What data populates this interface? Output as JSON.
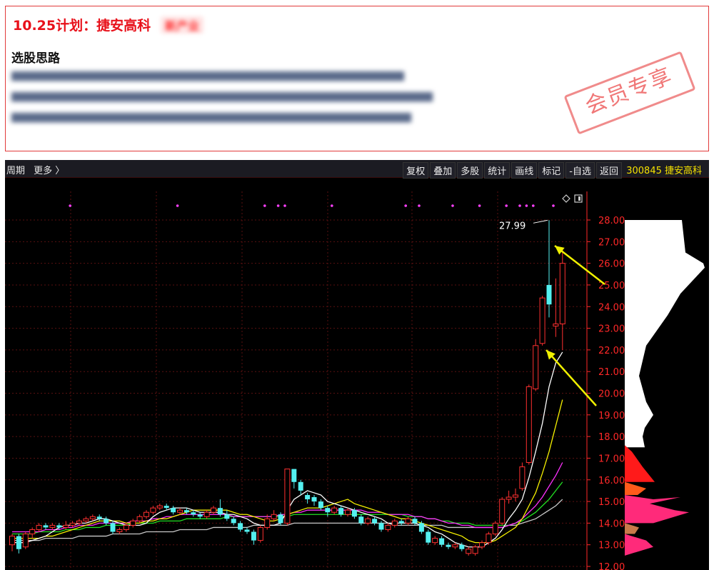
{
  "plan": {
    "title": "10.25计划：捷安高科",
    "badge": "新产业",
    "section_title": "选股思路",
    "stamp": "会员专享"
  },
  "toolbar": {
    "left_items": [
      "周期",
      "更多 〉"
    ],
    "buttons": [
      "复权",
      "叠加",
      "多股",
      "统计",
      "画线",
      "标记",
      "-自选",
      "返回"
    ],
    "stock": "300845 捷安高科"
  },
  "colors": {
    "up": "#ff3030",
    "down": "#54f0f0",
    "axis": "#ff2828",
    "ma5": "#ffffff",
    "ma10": "#f5f000",
    "ma20": "#ff30ff",
    "ma30": "#22e022",
    "ma60": "#c8c8c8",
    "arrow": "#f0f000"
  },
  "chart_data": {
    "type": "candlestick",
    "ylim": [
      12.0,
      28.0
    ],
    "y_ticks": [
      "28.00",
      "27.00",
      "26.00",
      "25.00",
      "24.00",
      "23.00",
      "22.00",
      "21.00",
      "20.00",
      "19.00",
      "18.00",
      "17.00",
      "16.00",
      "15.00",
      "14.00",
      "13.00",
      "12.00"
    ],
    "annotation": "27.99",
    "candles": [
      [
        13.0,
        13.4,
        12.7,
        13.5
      ],
      [
        13.4,
        12.8,
        12.6,
        13.5
      ],
      [
        12.9,
        13.5,
        12.8,
        13.6
      ],
      [
        13.5,
        13.7,
        13.3,
        13.8
      ],
      [
        13.7,
        13.9,
        13.6,
        14.0
      ],
      [
        13.9,
        13.8,
        13.7,
        14.0
      ],
      [
        13.8,
        13.9,
        13.7,
        14.0
      ],
      [
        13.9,
        13.8,
        13.7,
        14.0
      ],
      [
        13.8,
        13.9,
        13.7,
        14.1
      ],
      [
        13.9,
        14.0,
        13.8,
        14.1
      ],
      [
        14.0,
        14.1,
        13.9,
        14.2
      ],
      [
        14.1,
        14.2,
        14.0,
        14.3
      ],
      [
        14.2,
        14.3,
        14.1,
        14.4
      ],
      [
        14.3,
        14.2,
        14.1,
        14.4
      ],
      [
        14.2,
        14.0,
        13.9,
        14.3
      ],
      [
        14.0,
        13.6,
        13.5,
        14.1
      ],
      [
        13.6,
        13.7,
        13.5,
        13.8
      ],
      [
        13.7,
        13.9,
        13.6,
        14.0
      ],
      [
        13.9,
        14.1,
        13.8,
        14.2
      ],
      [
        14.1,
        14.3,
        14.0,
        14.4
      ],
      [
        14.3,
        14.5,
        14.2,
        14.6
      ],
      [
        14.5,
        14.7,
        14.4,
        14.8
      ],
      [
        14.7,
        14.8,
        14.6,
        14.9
      ],
      [
        14.8,
        14.7,
        14.6,
        14.9
      ],
      [
        14.7,
        14.5,
        14.4,
        14.8
      ],
      [
        14.5,
        14.6,
        14.4,
        14.7
      ],
      [
        14.6,
        14.5,
        14.4,
        14.7
      ],
      [
        14.5,
        14.4,
        14.3,
        14.6
      ],
      [
        14.4,
        14.3,
        14.2,
        14.5
      ],
      [
        14.3,
        14.5,
        14.2,
        14.6
      ],
      [
        14.5,
        14.7,
        14.4,
        14.8
      ],
      [
        14.7,
        14.4,
        14.3,
        15.1
      ],
      [
        14.4,
        14.2,
        14.1,
        14.6
      ],
      [
        14.2,
        14.0,
        13.9,
        14.3
      ],
      [
        14.0,
        13.7,
        13.6,
        14.1
      ],
      [
        13.7,
        13.6,
        13.5,
        13.8
      ],
      [
        13.6,
        13.2,
        13.0,
        13.7
      ],
      [
        13.2,
        13.8,
        13.1,
        13.9
      ],
      [
        13.8,
        14.2,
        13.7,
        14.4
      ],
      [
        14.2,
        14.4,
        14.1,
        14.6
      ],
      [
        14.4,
        14.0,
        13.9,
        14.5
      ],
      [
        14.0,
        16.5,
        13.9,
        16.5
      ],
      [
        16.5,
        15.9,
        15.6,
        16.3
      ],
      [
        15.9,
        15.5,
        15.3,
        16.0
      ],
      [
        15.3,
        15.1,
        14.9,
        15.4
      ],
      [
        15.2,
        15.0,
        14.8,
        15.3
      ],
      [
        15.0,
        14.7,
        14.6,
        15.1
      ],
      [
        14.7,
        14.5,
        14.3,
        14.8
      ],
      [
        14.5,
        14.7,
        14.4,
        14.8
      ],
      [
        14.7,
        14.4,
        14.3,
        14.8
      ],
      [
        14.4,
        14.6,
        14.3,
        14.7
      ],
      [
        14.6,
        14.3,
        14.2,
        14.7
      ],
      [
        14.3,
        14.0,
        13.9,
        14.4
      ],
      [
        14.0,
        14.2,
        13.9,
        14.3
      ],
      [
        14.2,
        14.0,
        13.9,
        14.3
      ],
      [
        14.0,
        13.7,
        13.6,
        14.1
      ],
      [
        13.7,
        13.9,
        13.6,
        14.0
      ],
      [
        13.9,
        14.1,
        13.8,
        14.2
      ],
      [
        14.1,
        14.0,
        13.9,
        14.2
      ],
      [
        14.0,
        14.2,
        13.9,
        14.3
      ],
      [
        14.2,
        14.0,
        13.9,
        14.3
      ],
      [
        14.0,
        13.6,
        13.5,
        14.1
      ],
      [
        13.6,
        13.1,
        13.0,
        13.7
      ],
      [
        13.1,
        13.3,
        13.0,
        13.4
      ],
      [
        13.3,
        13.0,
        12.9,
        13.4
      ],
      [
        13.0,
        12.9,
        12.8,
        13.1
      ],
      [
        12.9,
        13.0,
        12.8,
        13.1
      ],
      [
        13.0,
        12.8,
        12.7,
        13.1
      ],
      [
        12.6,
        12.8,
        12.5,
        12.9
      ],
      [
        12.6,
        12.9,
        12.5,
        13.0
      ],
      [
        12.9,
        13.1,
        12.8,
        13.2
      ],
      [
        13.1,
        13.5,
        13.0,
        13.6
      ],
      [
        13.5,
        14.0,
        13.4,
        14.1
      ],
      [
        14.0,
        15.1,
        13.9,
        15.2
      ],
      [
        15.1,
        15.2,
        14.9,
        15.5
      ],
      [
        15.2,
        15.3,
        15.0,
        15.6
      ],
      [
        15.6,
        16.6,
        15.5,
        16.8
      ],
      [
        16.8,
        20.3,
        16.7,
        20.4
      ],
      [
        20.2,
        22.2,
        20.1,
        22.5
      ],
      [
        22.3,
        24.4,
        22.2,
        24.5
      ],
      [
        25.0,
        24.1,
        23.5,
        27.99
      ],
      [
        23.1,
        23.2,
        22.6,
        25.3
      ],
      [
        23.2,
        26.0,
        22.0,
        26.7
      ]
    ],
    "ma5": [
      13.1,
      13.1,
      13.1,
      13.2,
      13.3,
      13.4,
      13.6,
      13.8,
      13.9,
      13.9,
      14.0,
      14.0,
      14.1,
      14.2,
      14.2,
      14.1,
      14.0,
      13.9,
      13.9,
      13.9,
      14.0,
      14.3,
      14.5,
      14.6,
      14.7,
      14.7,
      14.7,
      14.6,
      14.5,
      14.5,
      14.5,
      14.5,
      14.4,
      14.4,
      14.3,
      14.2,
      14.0,
      13.9,
      13.9,
      13.9,
      14.0,
      14.6,
      15.1,
      15.3,
      15.5,
      15.4,
      15.3,
      15.0,
      14.9,
      14.8,
      14.7,
      14.6,
      14.5,
      14.4,
      14.3,
      14.2,
      14.0,
      14.0,
      14.0,
      14.0,
      14.0,
      13.9,
      13.8,
      13.6,
      13.5,
      13.3,
      13.1,
      13.0,
      12.9,
      12.9,
      12.9,
      13.1,
      13.3,
      13.7,
      14.2,
      14.6,
      15.1,
      16.1,
      17.3,
      18.6,
      20.3,
      21.4,
      21.9
    ],
    "ma10": [
      13.3,
      13.3,
      13.3,
      13.3,
      13.3,
      13.4,
      13.4,
      13.5,
      13.6,
      13.7,
      13.8,
      13.9,
      14.0,
      14.1,
      14.1,
      14.1,
      14.1,
      14.0,
      14.0,
      14.0,
      14.1,
      14.1,
      14.2,
      14.2,
      14.3,
      14.4,
      14.5,
      14.6,
      14.6,
      14.6,
      14.6,
      14.6,
      14.6,
      14.5,
      14.4,
      14.4,
      14.3,
      14.2,
      14.1,
      14.1,
      14.2,
      14.4,
      14.5,
      14.6,
      14.7,
      14.7,
      14.7,
      14.8,
      14.9,
      15.0,
      15.1,
      14.9,
      14.8,
      14.7,
      14.6,
      14.5,
      14.4,
      14.3,
      14.2,
      14.2,
      14.1,
      14.0,
      13.9,
      13.8,
      13.7,
      13.6,
      13.5,
      13.4,
      13.2,
      13.1,
      13.1,
      13.1,
      13.2,
      13.4,
      13.6,
      13.8,
      14.2,
      14.8,
      15.4,
      16.3,
      17.3,
      18.5,
      19.7
    ],
    "ma20": [
      13.6,
      13.6,
      13.6,
      13.6,
      13.6,
      13.7,
      13.7,
      13.7,
      13.8,
      13.8,
      13.9,
      13.9,
      13.9,
      14.0,
      14.0,
      14.0,
      14.0,
      14.0,
      14.1,
      14.1,
      14.1,
      14.2,
      14.2,
      14.3,
      14.3,
      14.4,
      14.4,
      14.4,
      14.4,
      14.4,
      14.4,
      14.4,
      14.4,
      14.3,
      14.3,
      14.3,
      14.3,
      14.3,
      14.3,
      14.3,
      14.4,
      14.4,
      14.5,
      14.5,
      14.6,
      14.6,
      14.6,
      14.6,
      14.6,
      14.6,
      14.6,
      14.6,
      14.6,
      14.5,
      14.5,
      14.5,
      14.4,
      14.4,
      14.4,
      14.4,
      14.3,
      14.3,
      14.2,
      14.2,
      14.1,
      14.0,
      14.0,
      13.9,
      13.9,
      13.8,
      13.8,
      13.8,
      13.8,
      13.8,
      13.9,
      14.0,
      14.2,
      14.5,
      14.8,
      15.2,
      15.7,
      16.2,
      16.8
    ],
    "ma30": [
      13.5,
      13.5,
      13.5,
      13.5,
      13.6,
      13.6,
      13.6,
      13.6,
      13.7,
      13.7,
      13.7,
      13.8,
      13.8,
      13.8,
      13.9,
      13.9,
      13.9,
      13.9,
      14.0,
      14.0,
      14.0,
      14.0,
      14.1,
      14.1,
      14.1,
      14.1,
      14.2,
      14.2,
      14.2,
      14.2,
      14.2,
      14.2,
      14.3,
      14.3,
      14.3,
      14.3,
      14.3,
      14.3,
      14.3,
      14.3,
      14.3,
      14.3,
      14.4,
      14.4,
      14.4,
      14.4,
      14.4,
      14.4,
      14.4,
      14.4,
      14.4,
      14.4,
      14.4,
      14.4,
      14.4,
      14.4,
      14.4,
      14.4,
      14.4,
      14.3,
      14.3,
      14.3,
      14.2,
      14.2,
      14.1,
      14.1,
      14.0,
      14.0,
      14.0,
      13.9,
      13.9,
      13.9,
      13.9,
      13.9,
      13.9,
      14.0,
      14.1,
      14.3,
      14.5,
      14.8,
      15.1,
      15.5,
      15.9
    ],
    "ma60": [
      13.2,
      13.2,
      13.2,
      13.2,
      13.2,
      13.3,
      13.3,
      13.3,
      13.3,
      13.3,
      13.4,
      13.4,
      13.4,
      13.4,
      13.4,
      13.5,
      13.5,
      13.5,
      13.5,
      13.5,
      13.6,
      13.6,
      13.6,
      13.6,
      13.6,
      13.7,
      13.7,
      13.7,
      13.7,
      13.7,
      13.8,
      13.8,
      13.8,
      13.8,
      13.8,
      13.8,
      13.9,
      13.9,
      13.9,
      13.9,
      13.9,
      13.9,
      14.0,
      14.0,
      14.0,
      14.0,
      14.0,
      14.0,
      14.0,
      14.0,
      14.0,
      14.0,
      14.0,
      14.0,
      14.0,
      14.0,
      14.0,
      13.9,
      13.9,
      13.9,
      13.9,
      13.9,
      13.9,
      13.9,
      13.9,
      13.8,
      13.8,
      13.8,
      13.8,
      13.8,
      13.8,
      13.8,
      13.8,
      13.8,
      13.9,
      13.9,
      14.0,
      14.1,
      14.2,
      14.4,
      14.6,
      14.8,
      15.1
    ]
  }
}
